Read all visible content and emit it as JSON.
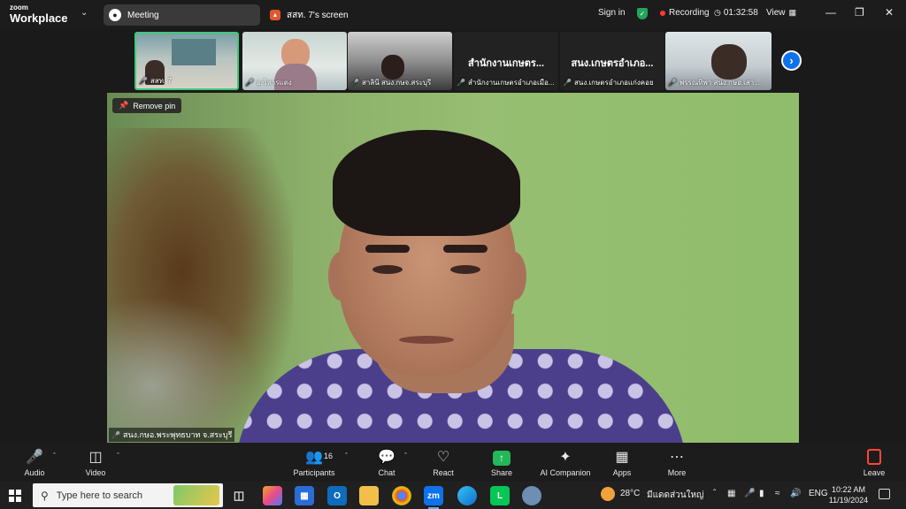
{
  "app": {
    "logo_small": "zoom",
    "logo_big": "Workplace"
  },
  "tabs": [
    {
      "label": "Meeting",
      "icon": "paw-icon"
    },
    {
      "label": "สสท. 7's screen",
      "icon": "share-screen-icon"
    }
  ],
  "header": {
    "sign_in": "Sign in",
    "recording": "Recording",
    "timer": "01:32:58",
    "view": "View"
  },
  "gallery": [
    {
      "name": "สสท. 7",
      "title": ""
    },
    {
      "name": "อ.วิหารแดง",
      "title": ""
    },
    {
      "name": "สาลินี สนง.กษจ.สระบุรี",
      "title": ""
    },
    {
      "name": "สำนักงานเกษตรอำเภอเมือ...",
      "title": "สำนักงานเกษตร..."
    },
    {
      "name": "สนง.เกษตรอำเภอแก่งคอย",
      "title": "สนง.เกษตรอำเภอ..."
    },
    {
      "name": "พรรณทิพา สนง.กษอ.เสา...",
      "title": ""
    }
  ],
  "main_video": {
    "pin_label": "Remove pin",
    "name": "สนง.กษอ.พระพุทธบาท จ.สระบุรี"
  },
  "toolbar": {
    "audio": "Audio",
    "video": "Video",
    "participants": "Participants",
    "participant_count": "16",
    "chat": "Chat",
    "react": "React",
    "share": "Share",
    "ai": "AI Companion",
    "apps": "Apps",
    "more": "More",
    "leave": "Leave"
  },
  "taskbar": {
    "search_placeholder": "Type here to search",
    "weather_temp": "28°C",
    "weather_text": "มีแดดส่วนใหญ่",
    "lang": "ENG",
    "time": "10:22 AM",
    "date": "11/19/2024"
  },
  "colors": {
    "accent": "#0e72ed",
    "active_speaker": "#3ecb7a",
    "share_green": "#23b85a",
    "record_red": "#ff3b30"
  }
}
